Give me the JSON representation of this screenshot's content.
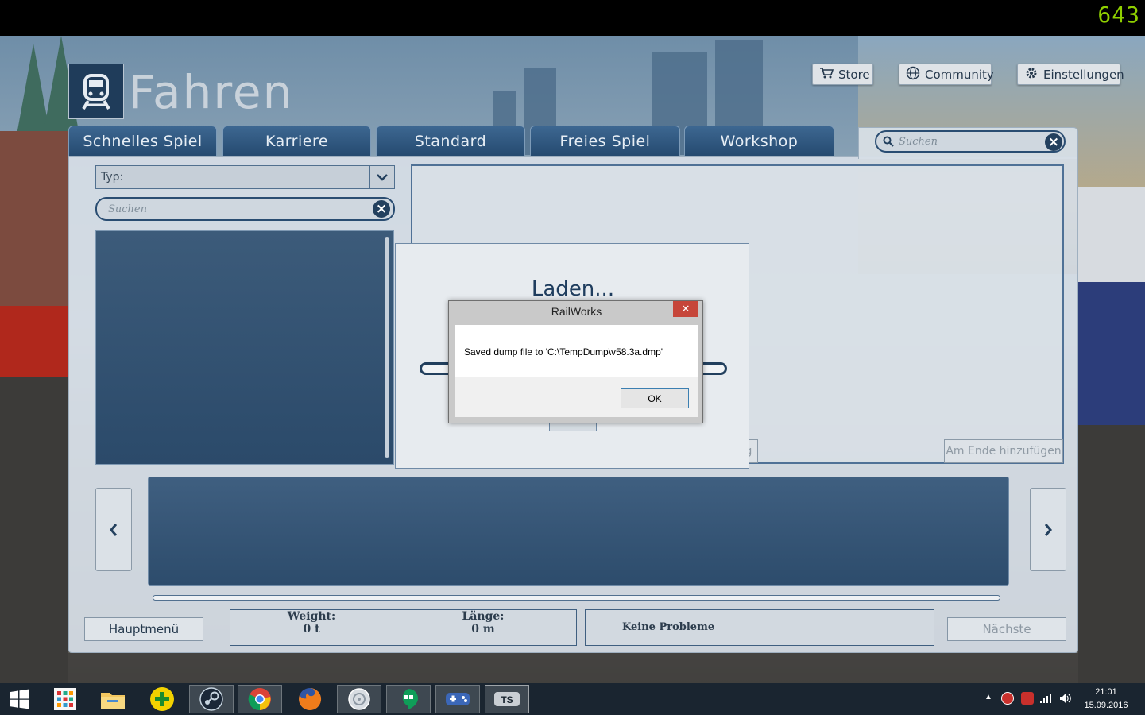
{
  "overlay": {
    "fps": "643"
  },
  "header": {
    "title": "Fahren"
  },
  "topnav": {
    "store": "Store",
    "community": "Community",
    "settings": "Einstellungen"
  },
  "tabs": [
    "Schnelles Spiel",
    "Karriere",
    "Standard",
    "Freies Spiel",
    "Workshop"
  ],
  "search": {
    "placeholder": "Suchen"
  },
  "left": {
    "type_label": "Typ:",
    "search_placeholder": "Suchen"
  },
  "right": {
    "append_button": "Am Ende hinzufügen",
    "hidden_button_fragment": "g"
  },
  "bottom": {
    "main_menu": "Hauptmenü",
    "weight_label": "Weight:",
    "weight_value": "0 t",
    "length_label": "Länge:",
    "length_value": "0 m",
    "status": "Keine Probleme",
    "next": "Nächste"
  },
  "loading": {
    "title": "Laden..."
  },
  "messagebox": {
    "title": "RailWorks",
    "close": "✕",
    "text": "Saved dump file to 'C:\\TempDump\\v58.3a.dmp'",
    "ok": "OK"
  },
  "taskbar": {
    "apps": [
      "start-icon",
      "apps-icon",
      "file-explorer-icon",
      "plus-app-icon",
      "steam-icon",
      "chrome-icon",
      "firefox-icon",
      "media-icon",
      "hangouts-icon",
      "game-controller-icon",
      "train-simulator-icon"
    ],
    "time": "21:01",
    "date": "15.09.2016"
  }
}
